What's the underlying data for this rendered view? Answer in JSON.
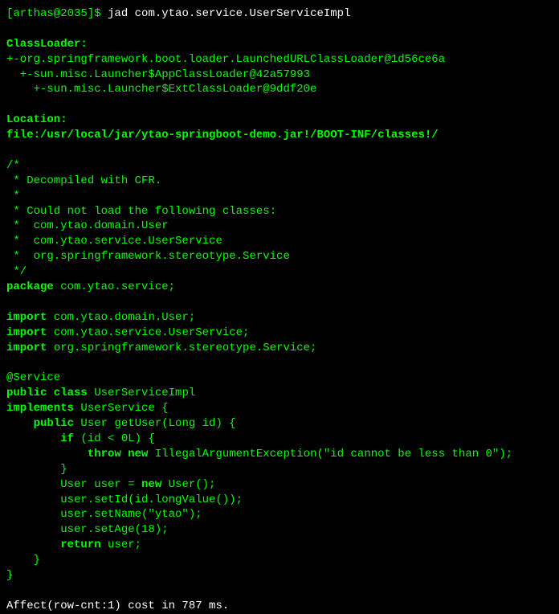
{
  "prompt_line": {
    "prompt": "[arthas@2035]$ ",
    "command": "jad com.ytao.service.UserServiceImpl"
  },
  "classloader": {
    "header": "ClassLoader:",
    "lines": [
      "+-org.springframework.boot.loader.LaunchedURLClassLoader@1d56ce6a",
      "  +-sun.misc.Launcher$AppClassLoader@42a57993",
      "    +-sun.misc.Launcher$ExtClassLoader@9ddf20e"
    ]
  },
  "location": {
    "header": "Location:",
    "path": "file:/usr/local/jar/ytao-springboot-demo.jar!/BOOT-INF/classes!/"
  },
  "decompiled": {
    "comment_open": "/*",
    "comment_lines": [
      " * Decompiled with CFR.",
      " *",
      " * Could not load the following classes:",
      " *  com.ytao.domain.User",
      " *  com.ytao.service.UserService",
      " *  org.springframework.stereotype.Service",
      " */"
    ],
    "package_kw": "package",
    "package_name": " com.ytao.service;",
    "import_kw": "import",
    "imports": [
      " com.ytao.domain.User;",
      " com.ytao.service.UserService;",
      " org.springframework.stereotype.Service;"
    ],
    "annotation": "@Service",
    "public_class_kw": "public class",
    "class_name": " UserServiceImpl",
    "implements_kw": "implements",
    "implements_name": " UserService {",
    "method_public_kw": "public",
    "method_sig": " User getUser(Long id) {",
    "if_kw": "if",
    "if_cond": " (id < 0L) {",
    "throw_kw": "throw new",
    "throw_expr": " IllegalArgumentException(\"id cannot be less than 0\");",
    "close_if": "        }",
    "user_decl": "        User user = ",
    "new_kw": "new",
    "user_ctor": " User();",
    "set_id": "        user.setId(id.longValue());",
    "set_name": "        user.setName(\"ytao\");",
    "set_age": "        user.setAge(18);",
    "return_kw": "return",
    "return_expr": " user;",
    "close_method": "    }",
    "close_class": "}"
  },
  "footer": "Affect(row-cnt:1) cost in 787 ms."
}
